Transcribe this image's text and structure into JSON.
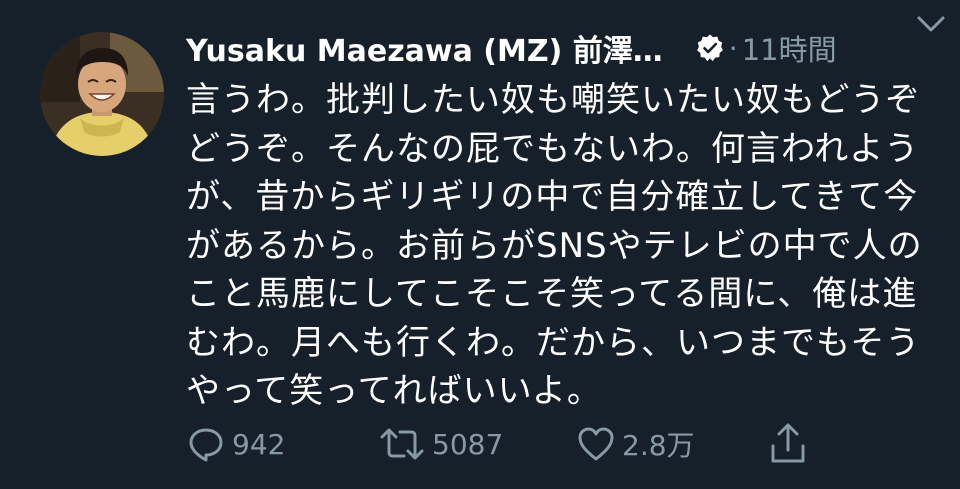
{
  "tweet": {
    "display_name": "Yusaku Maezawa (MZ) 前澤…",
    "separator": "·",
    "time": "11時間",
    "body_lines": [
      "言うわ。批判したい奴も嘲笑いたい奴もどうぞ",
      "どうぞ。そんなの屁でもないわ。何言われよう",
      "が、昔からギリギリの中で自分確立してきて今",
      "があるから。お前らがSNSやテレビの中で人の",
      "こと馬鹿にしてこそこそ笑ってる間に、俺は進",
      "むわ。月へも行くわ。だから、いつまでもそう",
      "やって笑ってればいいよ。"
    ],
    "actions": {
      "reply_count": "942",
      "retweet_count": "5087",
      "like_count": "2.8万"
    }
  },
  "icons": {
    "avatar": "avatar",
    "verified": "verified-badge-icon",
    "caret": "chevron-down-icon",
    "reply": "reply-icon",
    "retweet": "retweet-icon",
    "like": "heart-icon",
    "share": "share-icon"
  },
  "colors": {
    "background": "#15202b",
    "text": "#ffffff",
    "muted": "#8899a6"
  }
}
